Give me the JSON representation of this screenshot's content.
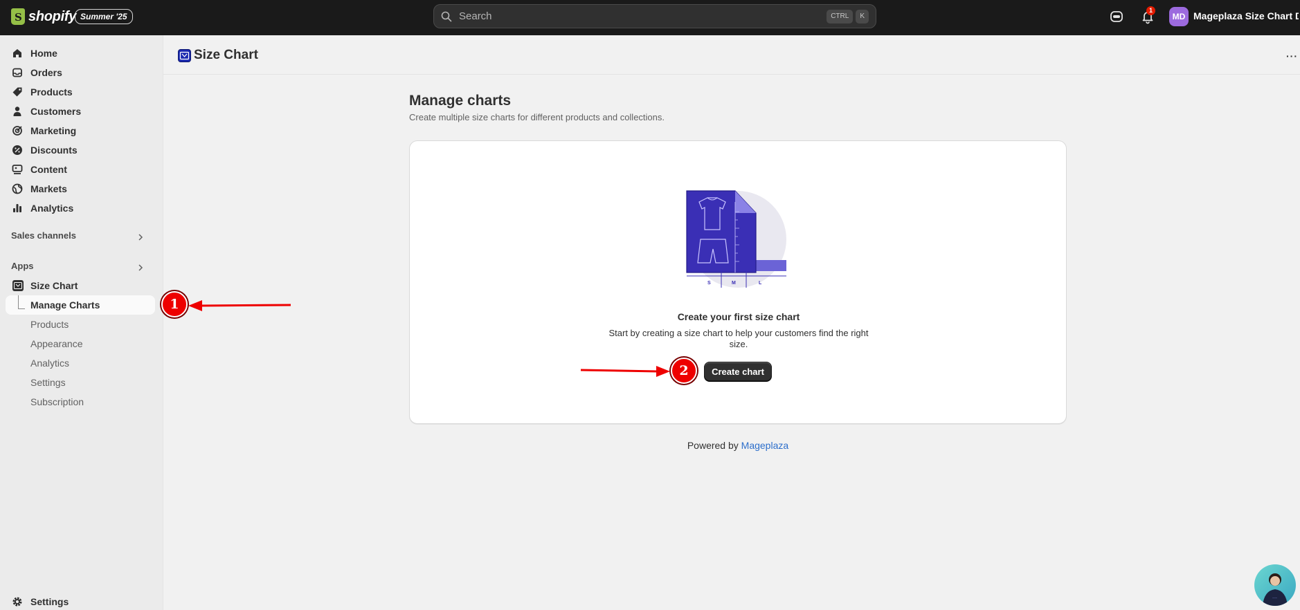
{
  "topbar": {
    "brand": "shopify",
    "edition_badge": "Summer '25",
    "search_placeholder": "Search",
    "shortcut_keys": [
      "CTRL",
      "K"
    ],
    "notification_count": "1",
    "avatar_initials": "MD",
    "store_name": "Mageplaza Size Chart De..."
  },
  "sidebar": {
    "nav": [
      "Home",
      "Orders",
      "Products",
      "Customers",
      "Marketing",
      "Discounts",
      "Content",
      "Markets",
      "Analytics"
    ],
    "sales_channels_label": "Sales channels",
    "apps_label": "Apps",
    "app_name": "Size Chart",
    "app_subitems": [
      "Manage Charts",
      "Products",
      "Appearance",
      "Analytics",
      "Settings",
      "Subscription"
    ],
    "active_subitem": "Manage Charts",
    "settings_label": "Settings"
  },
  "titlebar": {
    "title": "Size Chart",
    "more_label": "···"
  },
  "main": {
    "heading": "Manage charts",
    "subheading": "Create multiple size charts for different products and collections.",
    "empty_state": {
      "title": "Create your first size chart",
      "description": "Start by creating a size chart to help your customers find the right size.",
      "button_label": "Create chart",
      "size_labels": [
        "S",
        "M",
        "L"
      ]
    },
    "footer_prefix": "Powered by ",
    "footer_link": "Mageplaza"
  },
  "annotations": {
    "marker_1": "1",
    "marker_2": "2"
  },
  "colors": {
    "topbar_bg": "#1a1a1a",
    "accent_purple": "#3a2fb5",
    "link_blue": "#2c6ecb",
    "annotation_red": "#e00000"
  }
}
